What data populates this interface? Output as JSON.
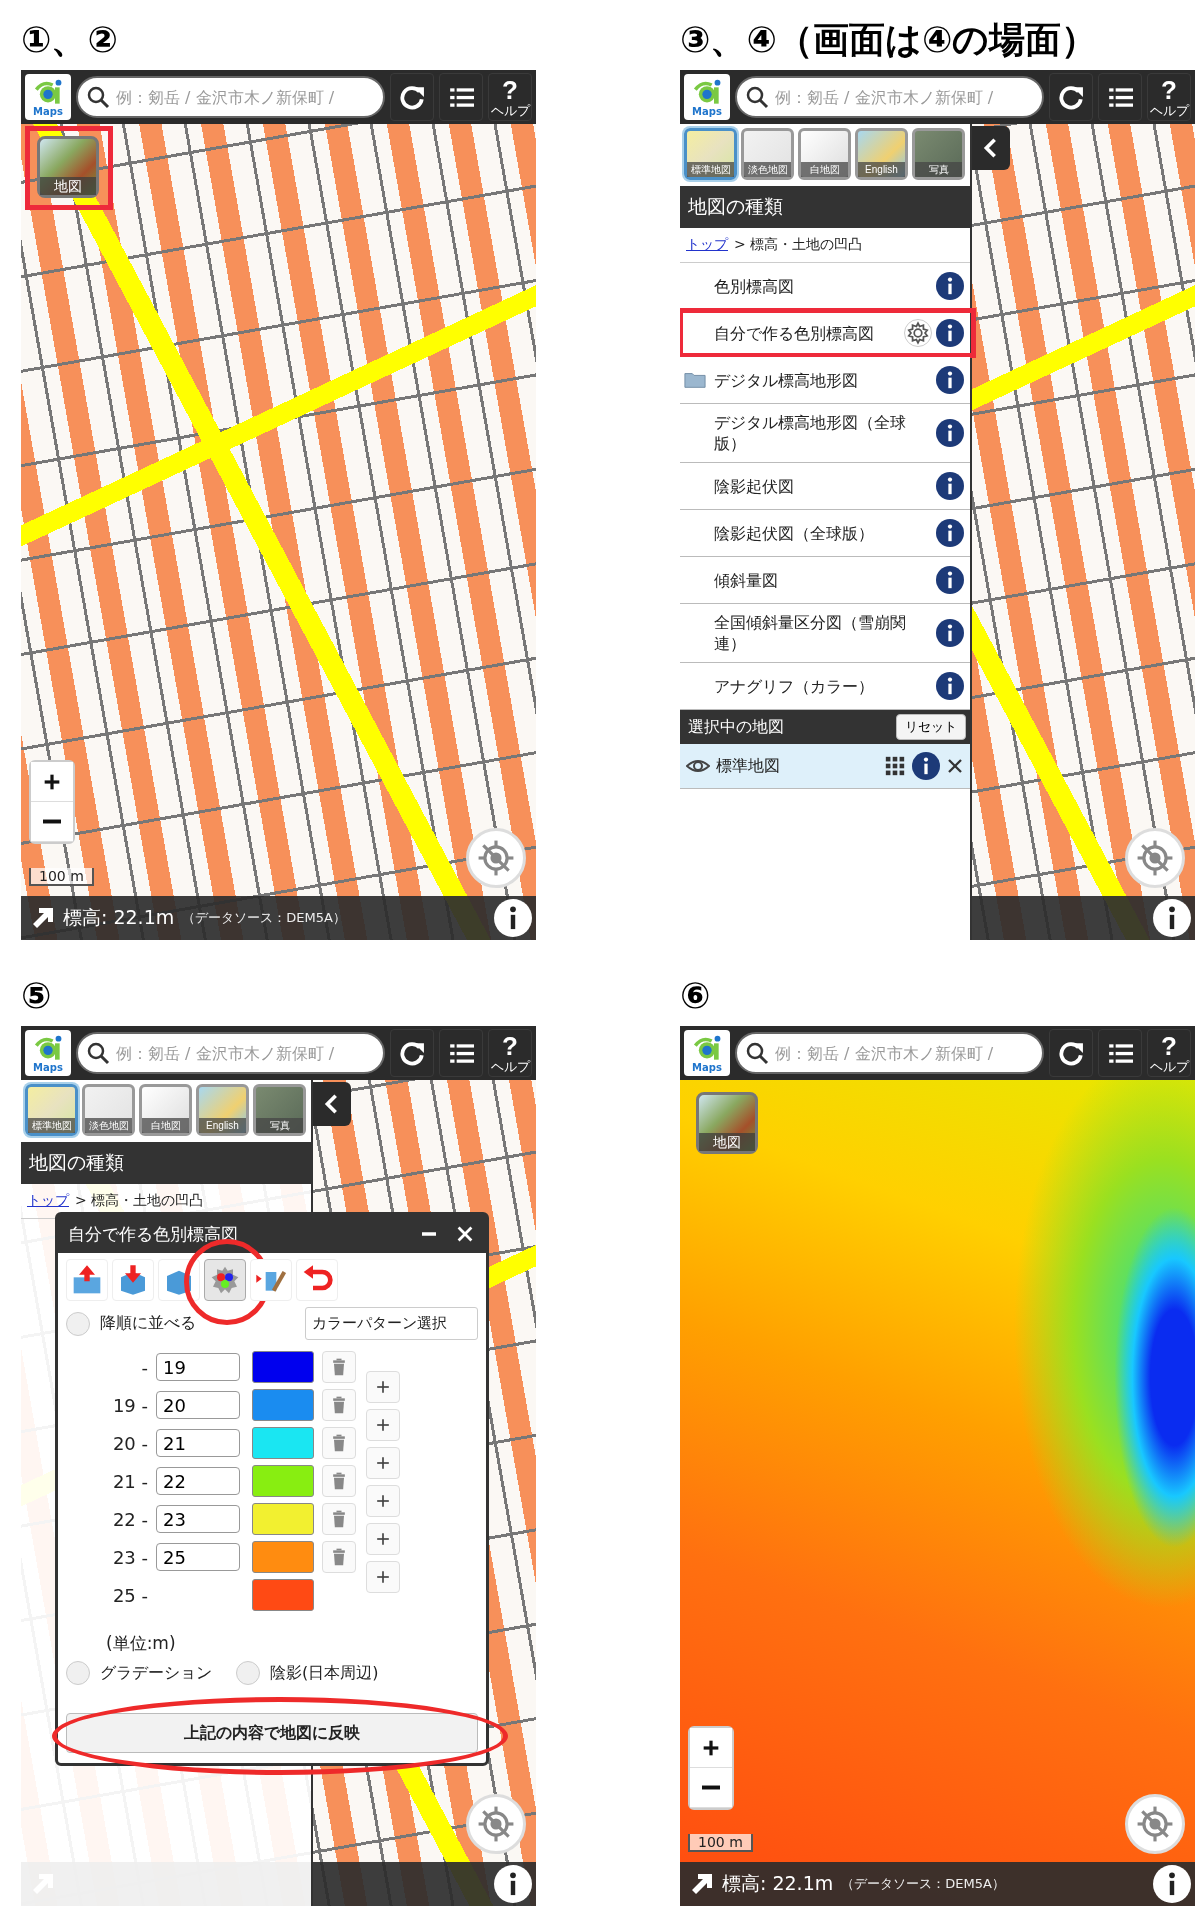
{
  "panels": [
    {
      "kind": "map_view",
      "title": "①、②",
      "topbar": {
        "logo_text": "Maps",
        "search_placeholder": "例：剱岳 / 金沢市木ノ新保町 /",
        "help_glyph": "?",
        "help_label": "ヘルプ"
      },
      "layer_button": {
        "label": "地図",
        "highlighted": true
      },
      "scale": "100 m",
      "status": {
        "elevation": "標高: 22.1m",
        "source": "（データソース：DEM5A）"
      }
    },
    {
      "kind": "layer_list",
      "title": "③、④（画面は④の場面）",
      "topbar": {
        "logo_text": "Maps",
        "search_placeholder": "例：剱岳 / 金沢市木ノ新保町 /",
        "help_glyph": "?",
        "help_label": "ヘルプ"
      },
      "sidebar": {
        "tiles": [
          {
            "label": "標準地図",
            "selected": true
          },
          {
            "label": "淡色地図",
            "selected": false
          },
          {
            "label": "白地図",
            "selected": false
          },
          {
            "label": "English",
            "selected": false
          },
          {
            "label": "写真",
            "selected": false
          }
        ],
        "heading": "地図の種類",
        "breadcrumb": {
          "link": "トップ",
          "path": "> 標高・土地の凹凸"
        },
        "items": [
          {
            "label": "色別標高図",
            "kind": "plain",
            "highlighted": false
          },
          {
            "label": "自分で作る色別標高図",
            "kind": "settings",
            "highlighted": true
          },
          {
            "label": "デジタル標高地形図",
            "kind": "folder",
            "highlighted": false
          },
          {
            "label": "デジタル標高地形図（全球版）",
            "kind": "plain",
            "highlighted": false
          },
          {
            "label": "陰影起伏図",
            "kind": "plain",
            "highlighted": false
          },
          {
            "label": "陰影起伏図（全球版）",
            "kind": "plain",
            "highlighted": false
          },
          {
            "label": "傾斜量図",
            "kind": "plain",
            "highlighted": false
          },
          {
            "label": "全国傾斜量区分図（雪崩関連）",
            "kind": "plain",
            "highlighted": false
          },
          {
            "label": "アナグリフ（カラー）",
            "kind": "plain",
            "highlighted": false
          }
        ],
        "selected_heading": "選択中の地図",
        "reset": "リセット",
        "selected_layers": [
          {
            "label": "標準地図"
          }
        ]
      }
    },
    {
      "kind": "color_dialog",
      "title": "⑤",
      "topbar": {
        "logo_text": "Maps",
        "search_placeholder": "例：剱岳 / 金沢市木ノ新保町 /",
        "help_glyph": "?",
        "help_label": "ヘルプ"
      },
      "sidebar": {
        "tiles": [
          {
            "label": "標準地図",
            "selected": true
          },
          {
            "label": "淡色地図",
            "selected": false
          },
          {
            "label": "白地図",
            "selected": false
          },
          {
            "label": "English",
            "selected": false
          },
          {
            "label": "写真",
            "selected": false
          }
        ],
        "heading": "地図の種類",
        "breadcrumb": {
          "link": "トップ",
          "path": "> 標高・土地の凹凸"
        }
      },
      "dialog": {
        "title": "自分で作る色別標高図",
        "tools": [
          {
            "kind": "upload",
            "highlighted": false
          },
          {
            "kind": "download",
            "highlighted": false
          },
          {
            "kind": "box",
            "highlighted": false
          },
          {
            "kind": "palette",
            "highlighted": true
          },
          {
            "kind": "pen",
            "highlighted": false
          },
          {
            "kind": "undo",
            "highlighted": false
          }
        ],
        "sort_option": {
          "label": "降順に並べる",
          "checked": false
        },
        "pattern_select": "カラーパターン選択",
        "ranges": [
          {
            "kind": "input",
            "label": "-",
            "value": "19",
            "color": "#0000ee"
          },
          {
            "kind": "input",
            "label": "19 -",
            "value": "20",
            "color": "#1a8cf0"
          },
          {
            "kind": "input",
            "label": "20 -",
            "value": "21",
            "color": "#1ae6f2"
          },
          {
            "kind": "input",
            "label": "21 -",
            "value": "22",
            "color": "#88ee11"
          },
          {
            "kind": "input",
            "label": "22 -",
            "value": "23",
            "color": "#f2f030"
          },
          {
            "kind": "input",
            "label": "23 -",
            "value": "25",
            "color": "#ff8c10"
          },
          {
            "kind": "last",
            "label": "25 -",
            "color": "#ff4a14"
          }
        ],
        "unit": "(単位:m)",
        "options": [
          {
            "label": "グラデーション",
            "checked": false
          },
          {
            "label": "陰影(日本周辺)",
            "checked": false
          }
        ],
        "apply": "上記の内容で地図に反映",
        "apply_highlighted": true
      }
    },
    {
      "kind": "elevation_view",
      "title": "⑥",
      "topbar": {
        "logo_text": "Maps",
        "search_placeholder": "例：剱岳 / 金沢市木ノ新保町 /",
        "help_glyph": "?",
        "help_label": "ヘルプ"
      },
      "layer_button": {
        "label": "地図",
        "highlighted": false
      },
      "scale": "100 m",
      "status": {
        "elevation": "標高: 22.1m",
        "source": "（データソース：DEM5A）"
      }
    }
  ]
}
